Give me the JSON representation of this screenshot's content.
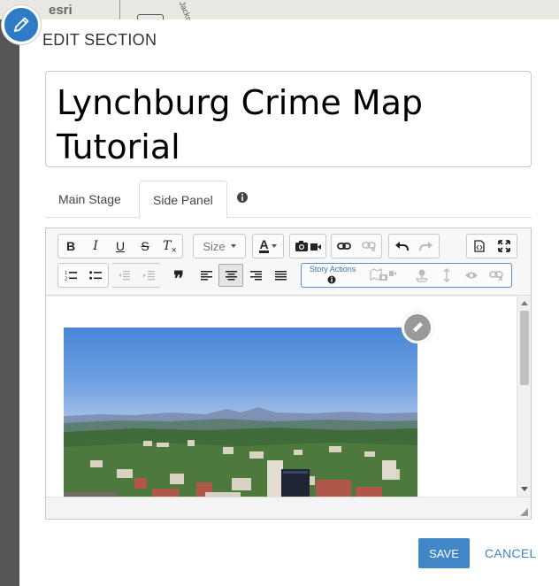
{
  "background": {
    "logo_text": "esri",
    "street_text": "Jacks"
  },
  "modal": {
    "title": "EDIT SECTION"
  },
  "section_title": "Lynchburg Crime Map Tutorial",
  "tabs": [
    {
      "label": "Main Stage",
      "active": false
    },
    {
      "label": "Side Panel",
      "active": true
    }
  ],
  "toolbar": {
    "bold": "B",
    "italic": "I",
    "underline": "U",
    "strike": "S",
    "clear": "T",
    "size_label": "Size",
    "font_color": "A",
    "blockquote": "❞",
    "story_actions_label": "Story Actions"
  },
  "buttons": {
    "save": "SAVE",
    "cancel": "CANCEL"
  },
  "colors": {
    "accent": "#3f87c7",
    "badge": "#2f7bc6"
  },
  "icons": {
    "edit_badge": "pencil-icon",
    "image_edit": "pencil-icon"
  }
}
